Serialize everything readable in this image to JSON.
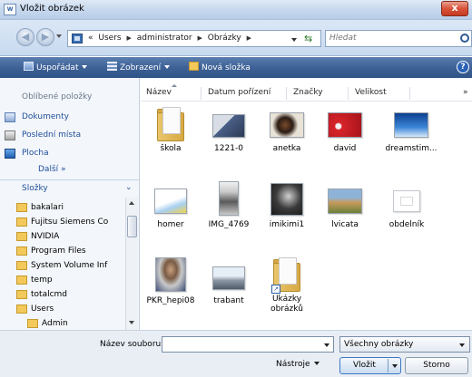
{
  "window": {
    "title": "Vložit obrázek",
    "close_label": "x"
  },
  "address": {
    "crumbs": [
      "«",
      "Users",
      "administrator",
      "Obrázky"
    ],
    "search_placeholder": "Hledat"
  },
  "toolbar": {
    "organize": "Uspořádat",
    "views": "Zobrazení",
    "new_folder": "Nová složka",
    "help": "?"
  },
  "sidebar": {
    "favorites_header": "Oblíbené položky",
    "favorites": [
      "Dokumenty",
      "Poslední místa",
      "Plocha"
    ],
    "more": "Další »",
    "folders_header": "Složky",
    "tree": [
      "bakalari",
      "Fujitsu Siemens Co",
      "NVIDIA",
      "Program Files",
      "System Volume Inf",
      "temp",
      "totalcmd",
      "Users",
      "Admin"
    ]
  },
  "columns": [
    "Název",
    "Datum pořízení",
    "Značky",
    "Velikost"
  ],
  "columns_more": "»",
  "files": [
    {
      "name": "škola",
      "kind": "folder"
    },
    {
      "name": "1221-0",
      "kind": "image",
      "palette": [
        "#d9dee6",
        "#4a5f86",
        "#2c3a55"
      ]
    },
    {
      "name": "anetka",
      "kind": "image",
      "palette": [
        "#e9e2d6",
        "#7a4a2b",
        "#2b1d14"
      ]
    },
    {
      "name": "david",
      "kind": "image",
      "palette": [
        "#d6242a",
        "#a5131a",
        "#f2f2f2"
      ]
    },
    {
      "name": "dreamstim...",
      "kind": "image",
      "palette": [
        "#0e3f8f",
        "#3c86d8",
        "#d6e8f9"
      ]
    },
    {
      "name": "homer",
      "kind": "image",
      "palette": [
        "#ffffff",
        "#a7cff0",
        "#f2d34a"
      ]
    },
    {
      "name": "IMG_4769",
      "kind": "image",
      "palette": [
        "#f0f0f0",
        "#5a5a5a",
        "#c9c9c9"
      ]
    },
    {
      "name": "imikimi1",
      "kind": "image",
      "palette": [
        "#3a3a3a",
        "#cfcfcf",
        "#1a1a1a"
      ]
    },
    {
      "name": "lvicata",
      "kind": "image",
      "palette": [
        "#8fb3d8",
        "#c89b5c",
        "#6b7f3a"
      ]
    },
    {
      "name": "obdelník",
      "kind": "image",
      "palette": [
        "#ffffff",
        "#ffffff",
        "#e2e2e2"
      ]
    },
    {
      "name": "PKR_hepi08",
      "kind": "image",
      "palette": [
        "#c9c9c9",
        "#7a5b44",
        "#3f4f77"
      ]
    },
    {
      "name": "trabant",
      "kind": "image",
      "palette": [
        "#e6eef6",
        "#8c98a6",
        "#4e5b68"
      ]
    },
    {
      "name": "Ukázky\nobrázků",
      "kind": "folder-shortcut"
    }
  ],
  "bottom": {
    "filename_label": "Název souboru:",
    "filename_value": "",
    "filetype": "Všechny obrázky",
    "tools": "Nástroje",
    "open": "Vložit",
    "cancel": "Storno"
  }
}
